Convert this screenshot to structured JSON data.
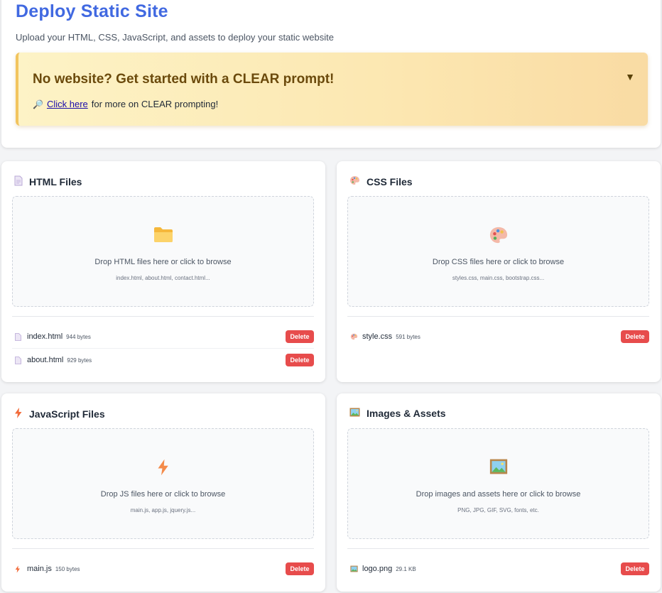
{
  "header": {
    "title": "Deploy Static Site",
    "subtitle": "Upload your HTML, CSS, JavaScript, and assets to deploy your static website"
  },
  "banner": {
    "title": "No website? Get started with a CLEAR prompt!",
    "toggle_glyph": "▼",
    "link_icon": "🔎",
    "link_text": "Click here",
    "link_suffix": "for more on CLEAR prompting!"
  },
  "sections": {
    "html": {
      "title": "HTML Files",
      "icon": "file-icon",
      "drop_text": "Drop HTML files here or click to browse",
      "drop_hint": "index.html, about.html, contact.html...",
      "files": [
        {
          "name": "index.html",
          "size": "944 bytes"
        },
        {
          "name": "about.html",
          "size": "929 bytes"
        }
      ]
    },
    "css": {
      "title": "CSS Files",
      "icon": "palette-icon",
      "drop_text": "Drop CSS files here or click to browse",
      "drop_hint": "styles.css, main.css, bootstrap.css...",
      "files": [
        {
          "name": "style.css",
          "size": "591 bytes"
        }
      ]
    },
    "js": {
      "title": "JavaScript Files",
      "icon": "lightning-icon",
      "drop_text": "Drop JS files here or click to browse",
      "drop_hint": "main.js, app.js, jquery.js...",
      "files": [
        {
          "name": "main.js",
          "size": "150 bytes"
        }
      ]
    },
    "assets": {
      "title": "Images & Assets",
      "icon": "picture-icon",
      "drop_text": "Drop images and assets here or click to browse",
      "drop_hint": "PNG, JPG, GIF, SVG, fonts, etc.",
      "files": [
        {
          "name": "logo.png",
          "size": "29.1 KB"
        }
      ]
    }
  },
  "delete_label": "Delete",
  "colors": {
    "title": "#4169e1",
    "delete": "#e74c4c",
    "banner_border": "#f2c45e"
  }
}
